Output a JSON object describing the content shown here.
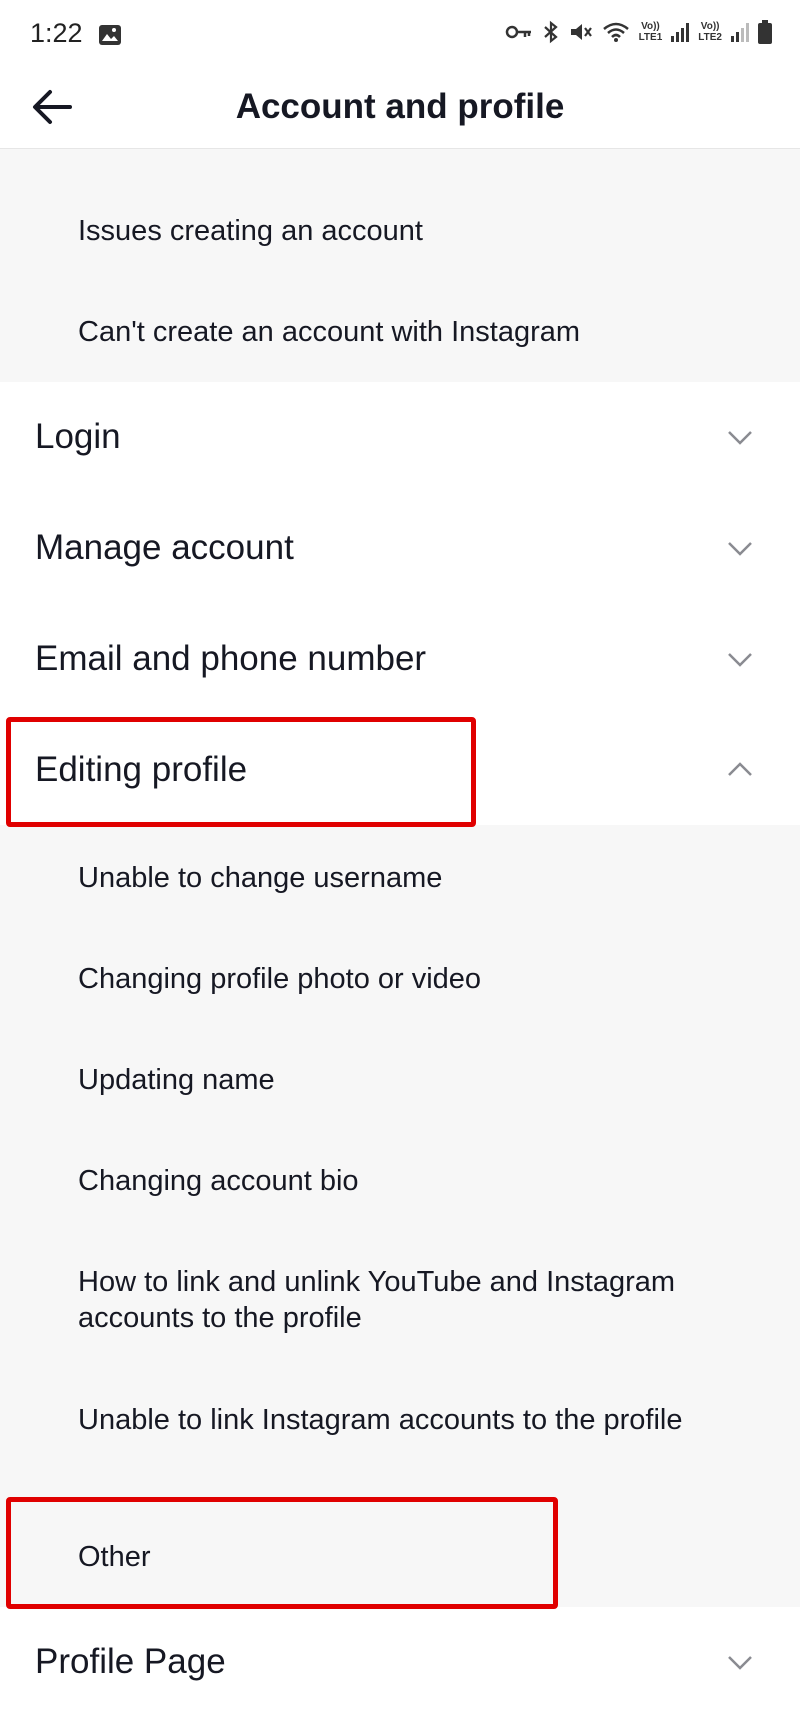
{
  "status_bar": {
    "time": "1:22",
    "sim1_line1": "Vo))",
    "sim1_line2": "LTE1",
    "sim2_line1": "Vo))",
    "sim2_line2": "LTE2"
  },
  "header": {
    "title": "Account and profile"
  },
  "creating_account_subitems": [
    "Issues creating an account",
    "Can't create an account with Instagram"
  ],
  "sections": [
    {
      "label": "Login",
      "expanded": false
    },
    {
      "label": "Manage account",
      "expanded": false
    },
    {
      "label": "Email and phone number",
      "expanded": false
    },
    {
      "label": "Editing profile",
      "expanded": true
    }
  ],
  "editing_profile_subitems": [
    "Unable to change username",
    "Changing profile photo or video",
    "Updating name",
    "Changing account bio",
    "How to link and unlink YouTube and Instagram accounts to the profile",
    "Unable to link Instagram accounts to the profile",
    "Other"
  ],
  "last_section": {
    "label": "Profile Page",
    "expanded": false
  },
  "colors": {
    "highlight": "#e00000",
    "sub_background": "#f7f7f7"
  }
}
